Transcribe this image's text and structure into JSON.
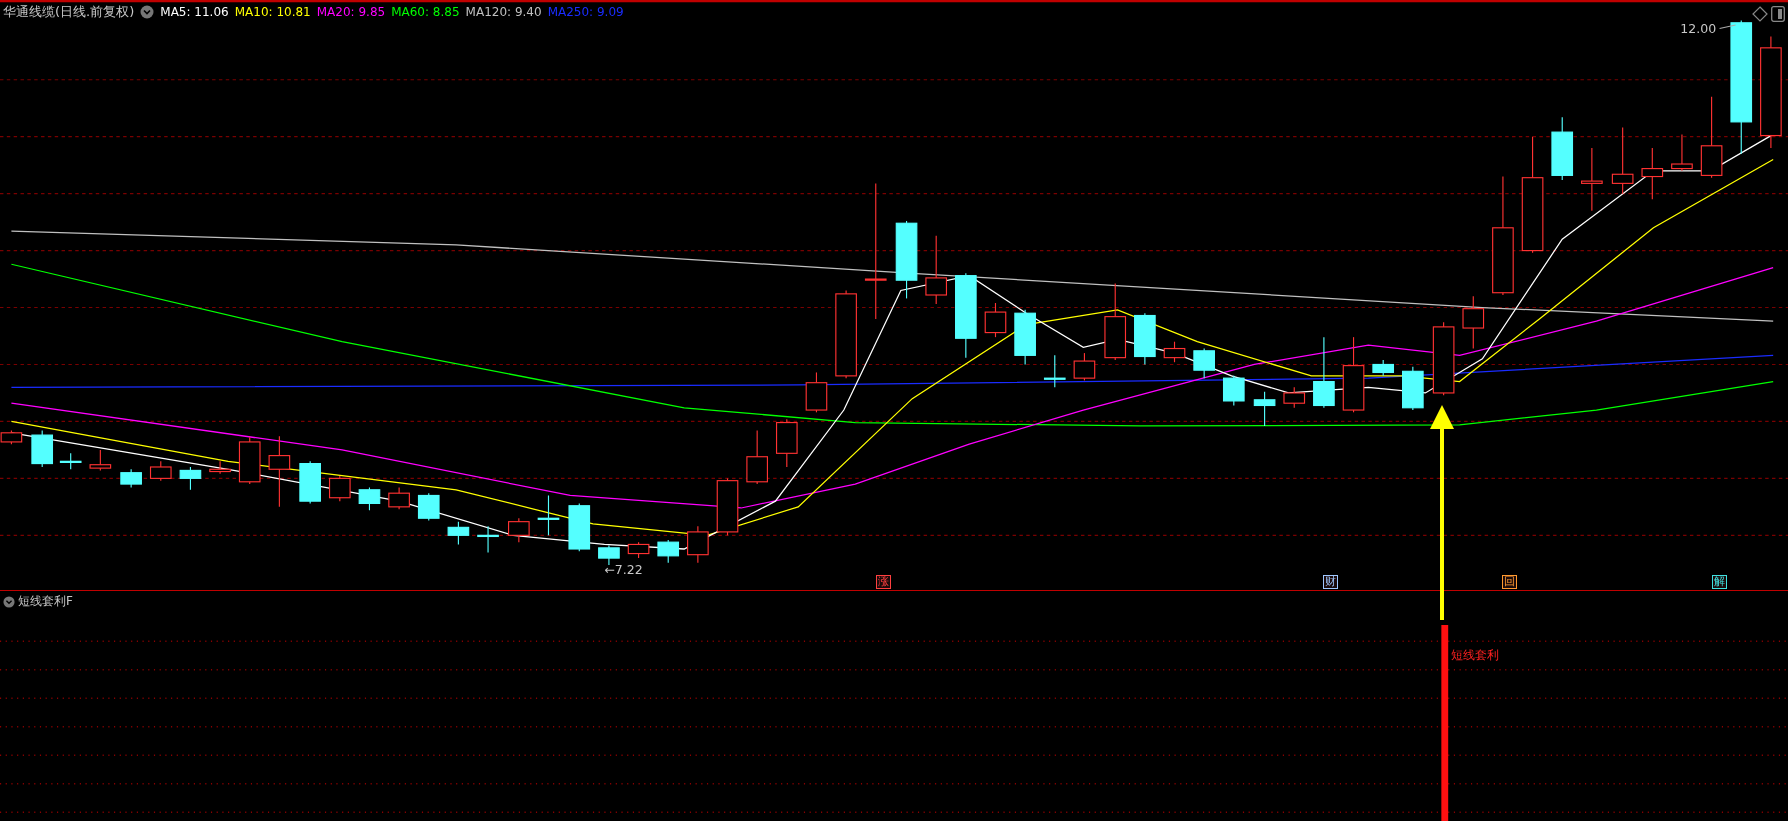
{
  "title": "华通线缆(日线.前复权)",
  "ma_legend": [
    {
      "label": "MA5: 11.06",
      "color": "#ffffff"
    },
    {
      "label": "MA10: 10.81",
      "color": "#ffff00"
    },
    {
      "label": "MA20: 9.85",
      "color": "#ff00ff"
    },
    {
      "label": "MA60: 8.85",
      "color": "#00ff00"
    },
    {
      "label": "MA120: 9.40",
      "color": "#c0c0c0"
    },
    {
      "label": "MA250: 9.09",
      "color": "#1a2cff"
    }
  ],
  "chart_labels": {
    "high": "12.00",
    "low": "←7.22"
  },
  "event_markers": [
    {
      "label": "涨",
      "color": "#ff4040"
    },
    {
      "label": "财",
      "color": "#a0c8ff"
    },
    {
      "label": "回",
      "color": "#ff9a30"
    },
    {
      "label": "解",
      "color": "#40e0e0"
    }
  ],
  "indicator_panel": {
    "title": "短线套利F",
    "signal_label": "短线套利"
  }
}
